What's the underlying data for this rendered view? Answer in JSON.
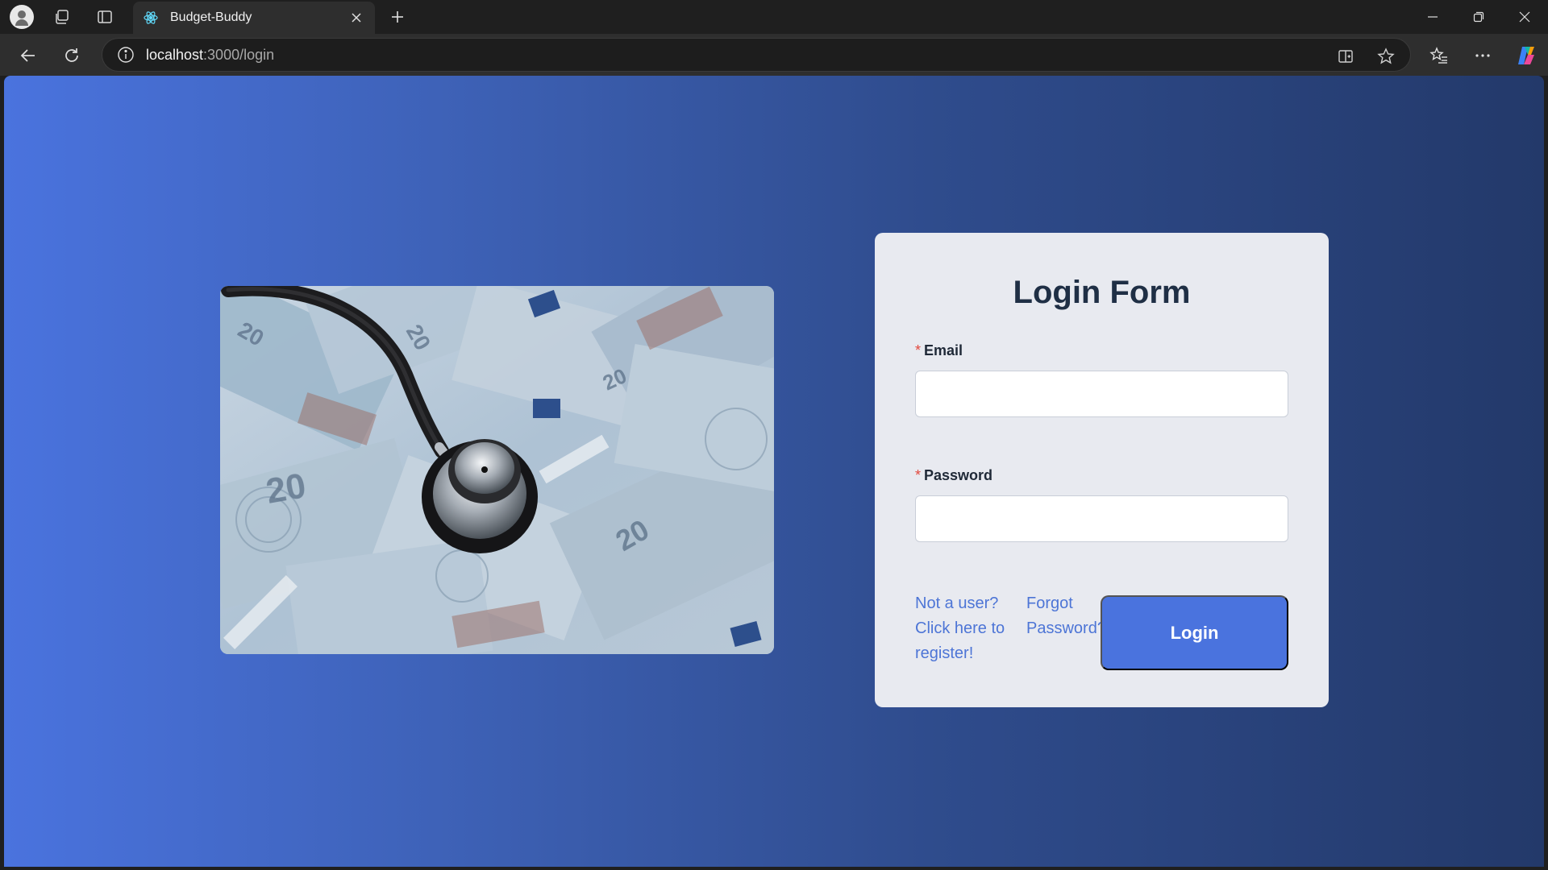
{
  "browser": {
    "tab_title": "Budget-Buddy",
    "url_host": "localhost",
    "url_path": ":3000/login",
    "icons": [
      "profile-icon",
      "workspaces-icon",
      "vertical-tabs-icon",
      "react-favicon",
      "close-tab-icon",
      "new-tab-icon",
      "minimize-icon",
      "restore-icon",
      "close-window-icon",
      "back-icon",
      "reload-icon",
      "site-info-icon",
      "split-screen-icon",
      "favorite-star-icon",
      "favorites-icon",
      "more-menu-icon",
      "copilot-icon"
    ]
  },
  "page": {
    "image_alt": "Stethoscope on euro banknotes",
    "form": {
      "title": "Login Form",
      "required_marker": "*",
      "email_label": "Email",
      "email_value": "",
      "password_label": "Password",
      "password_value": "",
      "register_link": "Not a user? Click here to register!",
      "forgot_link": "Forgot Password?",
      "login_button": "Login"
    }
  },
  "colors": {
    "accent": "#4a73de",
    "link": "#4d75d6",
    "title": "#1f2f45",
    "required": "#e2483d"
  }
}
